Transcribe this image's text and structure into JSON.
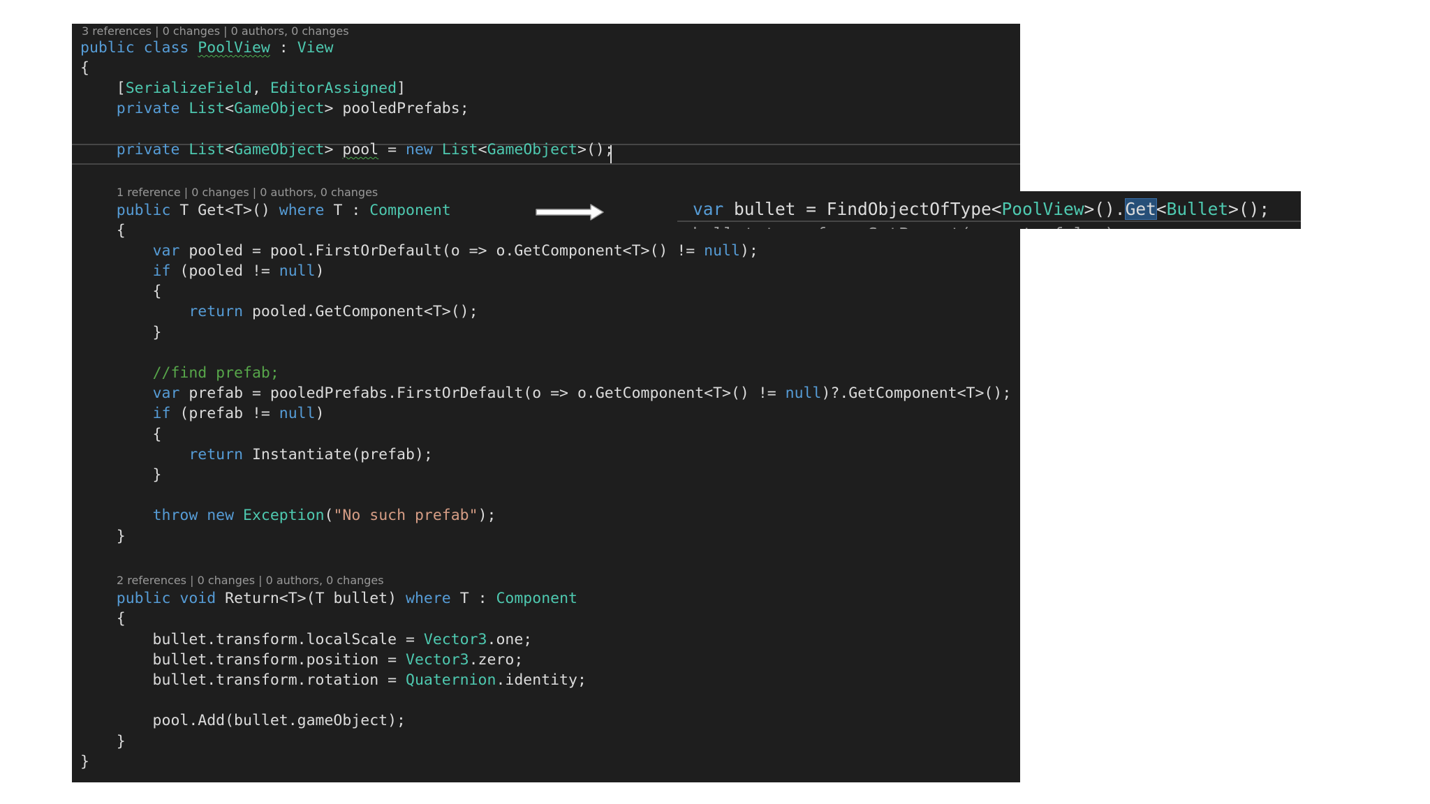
{
  "codelens": {
    "class": "3 references | 0 changes | 0 authors, 0 changes",
    "get": "1 reference | 0 changes | 0 authors, 0 changes",
    "return": "2 references | 0 changes | 0 authors, 0 changes"
  },
  "lines": [
    [
      {
        "t": "public class ",
        "c": "kw"
      },
      {
        "t": "PoolView",
        "c": "ty",
        "u": true
      },
      {
        "t": " : "
      },
      {
        "t": "View",
        "c": "ty"
      }
    ],
    [
      {
        "t": "{"
      }
    ],
    [
      {
        "t": "    ["
      },
      {
        "t": "SerializeField",
        "c": "ty"
      },
      {
        "t": ", "
      },
      {
        "t": "EditorAssigned",
        "c": "ty"
      },
      {
        "t": "]"
      }
    ],
    [
      {
        "t": "    "
      },
      {
        "t": "private ",
        "c": "kw"
      },
      {
        "t": "List",
        "c": "ty"
      },
      {
        "t": "<"
      },
      {
        "t": "GameObject",
        "c": "ty"
      },
      {
        "t": "> pooledPrefabs;"
      }
    ],
    [],
    [
      {
        "t": "    "
      },
      {
        "t": "private ",
        "c": "kw"
      },
      {
        "t": "List",
        "c": "ty"
      },
      {
        "t": "<"
      },
      {
        "t": "GameObject",
        "c": "ty"
      },
      {
        "t": "> "
      },
      {
        "t": "pool",
        "u": true
      },
      {
        "t": " = "
      },
      {
        "t": "new ",
        "c": "kw"
      },
      {
        "t": "List",
        "c": "ty"
      },
      {
        "t": "<"
      },
      {
        "t": "GameObject",
        "c": "ty"
      },
      {
        "t": ">();"
      }
    ],
    [],
    [
      {
        "t": "    "
      },
      {
        "t": "public ",
        "c": "kw"
      },
      {
        "t": "T Get<T>() "
      },
      {
        "t": "where ",
        "c": "kw"
      },
      {
        "t": "T : "
      },
      {
        "t": "Component",
        "c": "ty"
      }
    ],
    [
      {
        "t": "    {"
      }
    ],
    [
      {
        "t": "        "
      },
      {
        "t": "var ",
        "c": "kw"
      },
      {
        "t": "pooled = pool.FirstOrDefault(o => o.GetComponent<T>() != "
      },
      {
        "t": "null",
        "c": "kw"
      },
      {
        "t": ");"
      }
    ],
    [
      {
        "t": "        "
      },
      {
        "t": "if ",
        "c": "kw"
      },
      {
        "t": "(pooled != "
      },
      {
        "t": "null",
        "c": "kw"
      },
      {
        "t": ")"
      }
    ],
    [
      {
        "t": "        {"
      }
    ],
    [
      {
        "t": "            "
      },
      {
        "t": "return ",
        "c": "kw"
      },
      {
        "t": "pooled.GetComponent<T>();"
      }
    ],
    [
      {
        "t": "        }"
      }
    ],
    [],
    [
      {
        "t": "        "
      },
      {
        "t": "//find prefab;",
        "c": "cm"
      }
    ],
    [
      {
        "t": "        "
      },
      {
        "t": "var ",
        "c": "kw"
      },
      {
        "t": "prefab = pooledPrefabs.FirstOrDefault(o => o.GetComponent<T>() != "
      },
      {
        "t": "null",
        "c": "kw"
      },
      {
        "t": ")?.GetComponent<T>();"
      }
    ],
    [
      {
        "t": "        "
      },
      {
        "t": "if ",
        "c": "kw"
      },
      {
        "t": "(prefab != "
      },
      {
        "t": "null",
        "c": "kw"
      },
      {
        "t": ")"
      }
    ],
    [
      {
        "t": "        {"
      }
    ],
    [
      {
        "t": "            "
      },
      {
        "t": "return ",
        "c": "kw"
      },
      {
        "t": "Instantiate(prefab);"
      }
    ],
    [
      {
        "t": "        }"
      }
    ],
    [],
    [
      {
        "t": "        "
      },
      {
        "t": "throw ",
        "c": "kw"
      },
      {
        "t": "new ",
        "c": "kw"
      },
      {
        "t": "Exception",
        "c": "ty"
      },
      {
        "t": "("
      },
      {
        "t": "\"No such prefab\"",
        "c": "st"
      },
      {
        "t": ");"
      }
    ],
    [
      {
        "t": "    }"
      }
    ],
    [],
    [
      {
        "t": "    "
      },
      {
        "t": "public void ",
        "c": "kw"
      },
      {
        "t": "Return<T>(T bullet) "
      },
      {
        "t": "where ",
        "c": "kw"
      },
      {
        "t": "T : "
      },
      {
        "t": "Component",
        "c": "ty"
      }
    ],
    [
      {
        "t": "    {"
      }
    ],
    [
      {
        "t": "        bullet.transform.localScale = "
      },
      {
        "t": "Vector3",
        "c": "ty"
      },
      {
        "t": ".one;"
      }
    ],
    [
      {
        "t": "        bullet.transform.position = "
      },
      {
        "t": "Vector3",
        "c": "ty"
      },
      {
        "t": ".zero;"
      }
    ],
    [
      {
        "t": "        bullet.transform.rotation = "
      },
      {
        "t": "Quaternion",
        "c": "ty"
      },
      {
        "t": ".identity;"
      }
    ],
    [],
    [
      {
        "t": "        pool.Add(bullet.gameObject);"
      }
    ],
    [
      {
        "t": "    }"
      }
    ],
    [
      {
        "t": "}"
      }
    ]
  ],
  "snippet": {
    "tokens": [
      {
        "t": "var ",
        "c": "kw"
      },
      {
        "t": "bullet = FindObjectOfType<"
      },
      {
        "t": "PoolView",
        "c": "ty"
      },
      {
        "t": ">()."
      },
      {
        "t": "Get",
        "h": true
      },
      {
        "t": "<"
      },
      {
        "t": "Bullet",
        "c": "ty"
      },
      {
        "t": ">();"
      }
    ],
    "ghost": "bullet.transform.SetParent(parent, false);"
  },
  "colors": {
    "background": "#1e1e1e",
    "text": "#dcdcdc",
    "keyword": "#569cd6",
    "type": "#4ec9b0",
    "comment": "#57a64a",
    "string": "#d69d85",
    "codelens": "#999999",
    "selection": "#264f78"
  }
}
